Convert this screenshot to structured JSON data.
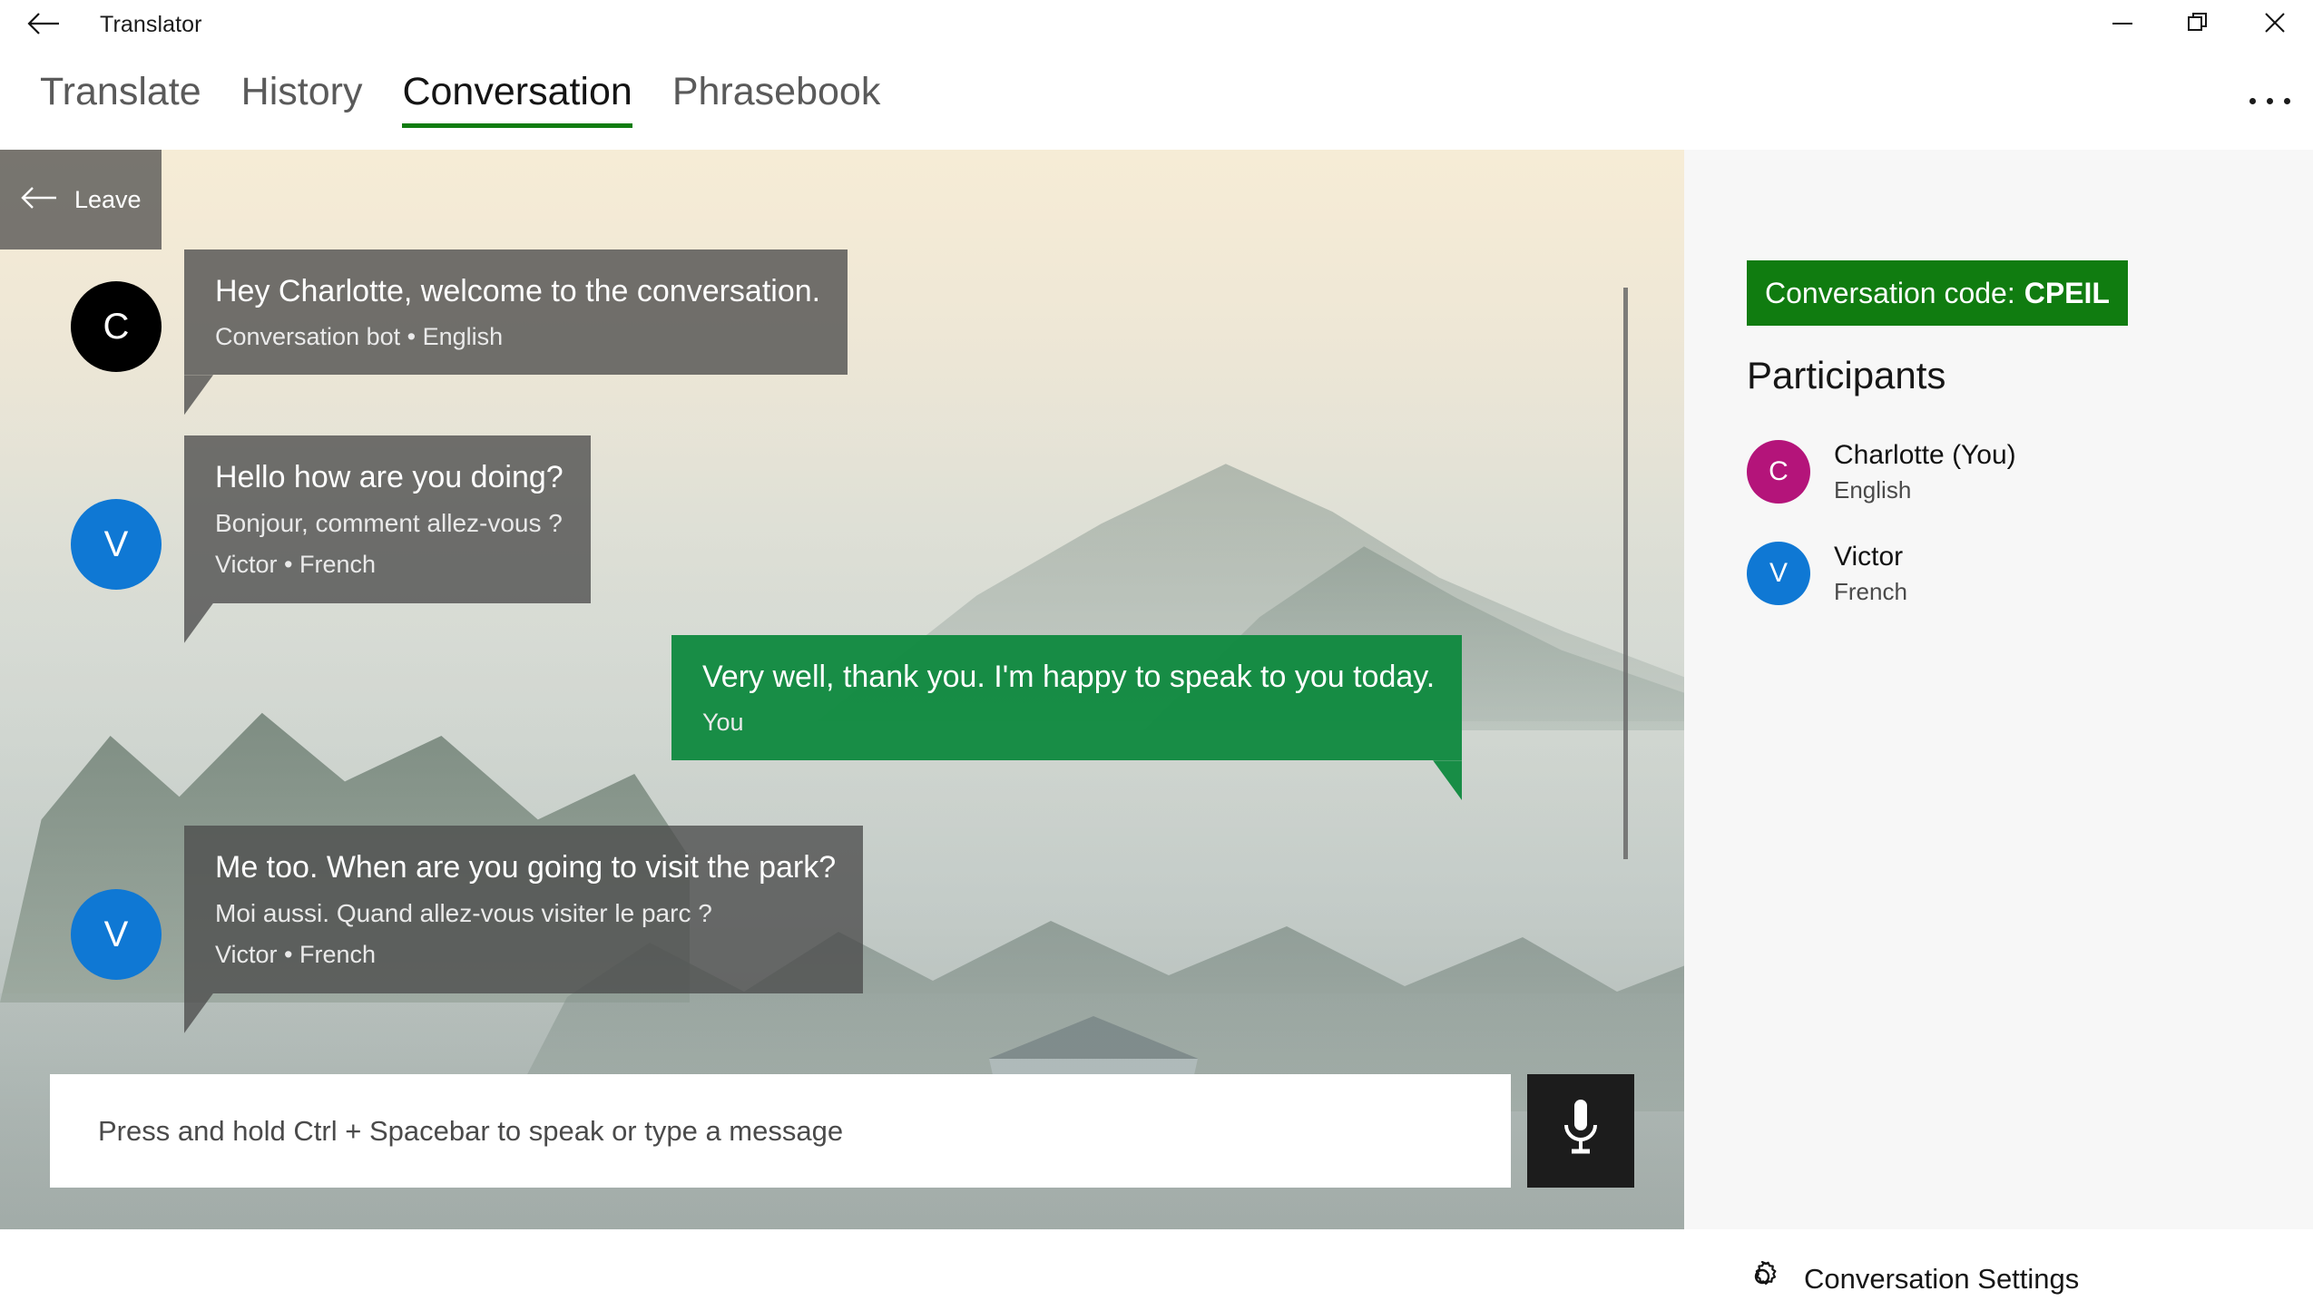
{
  "window": {
    "title": "Translator",
    "back_icon": "back-arrow-icon",
    "minimize_label": "Minimize",
    "restore_label": "Restore",
    "close_label": "Close"
  },
  "tabs": [
    {
      "label": "Translate",
      "active": false
    },
    {
      "label": "History",
      "active": false
    },
    {
      "label": "Conversation",
      "active": true
    },
    {
      "label": "Phrasebook",
      "active": false
    }
  ],
  "overflow_menu": {
    "label": "See more"
  },
  "conversation": {
    "leave_label": "Leave",
    "messages": [
      {
        "initial": "C",
        "avatar_color": "#000000",
        "primary": "Hey Charlotte, welcome to the conversation.",
        "secondary": "",
        "meta": "Conversation bot • English",
        "side": "left"
      },
      {
        "initial": "V",
        "avatar_color": "#0f78d4",
        "primary": "Hello how are you doing?",
        "secondary": "Bonjour, comment allez-vous ?",
        "meta": "Victor • French",
        "side": "left"
      },
      {
        "initial": "",
        "avatar_color": "",
        "primary": "Very well, thank you. I'm happy to speak to you today.",
        "secondary": "",
        "meta": "You",
        "side": "right"
      },
      {
        "initial": "V",
        "avatar_color": "#0f78d4",
        "primary": "Me too. When are you going to visit the park?",
        "secondary": "Moi aussi. Quand allez-vous visiter le parc ?",
        "meta": "Victor • French",
        "side": "left"
      }
    ],
    "input": {
      "value": "",
      "placeholder": "Press and hold Ctrl + Spacebar to speak or type a message",
      "mic_icon": "microphone-icon"
    }
  },
  "sidebar": {
    "code_label": "Conversation code:",
    "code_value": "CPEIL",
    "participants_title": "Participants",
    "participants": [
      {
        "initial": "C",
        "name": "Charlotte (You)",
        "language": "English",
        "color": "#b4147a"
      },
      {
        "initial": "V",
        "name": "Victor",
        "language": "French",
        "color": "#0f78d4"
      }
    ],
    "settings_label": "Conversation Settings",
    "settings_icon": "gear-icon"
  },
  "colors": {
    "accent_green": "#107c10",
    "bubble_green": "#0e893e",
    "bubble_gray": "rgba(75,75,75,.78)",
    "sidebar_bg": "#f7f7f7"
  }
}
